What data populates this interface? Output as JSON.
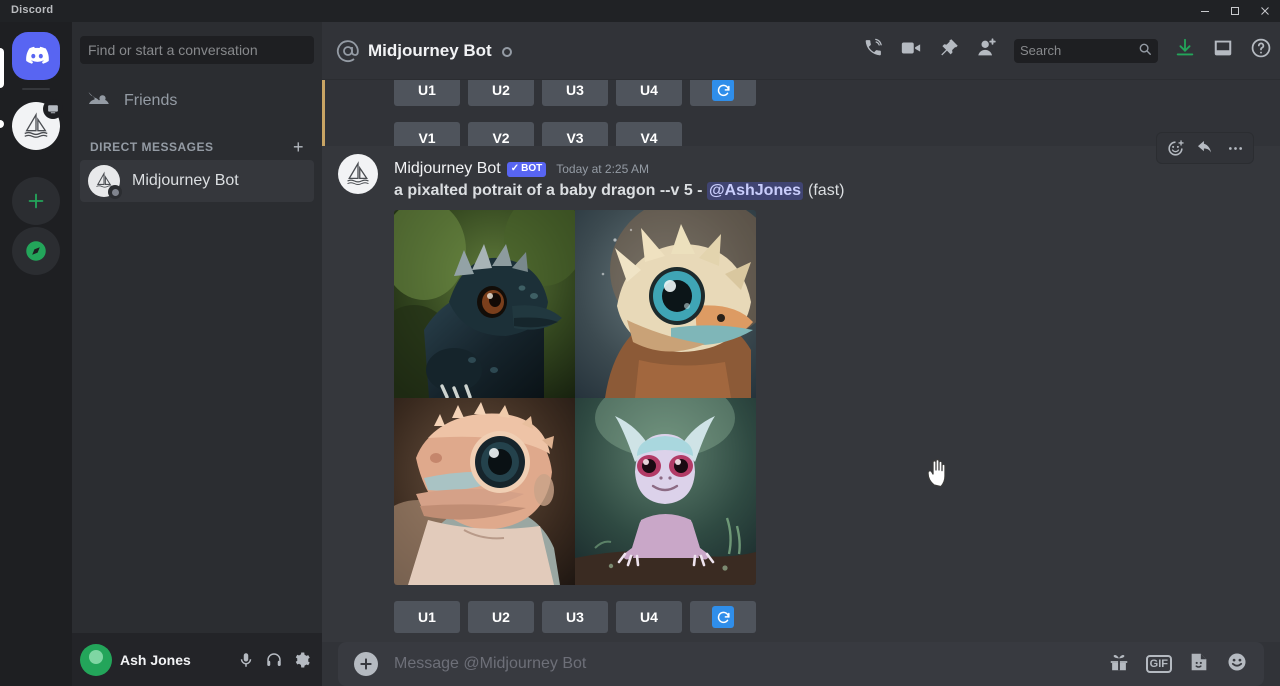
{
  "window": {
    "brand": "Discord",
    "controls": [
      {
        "name": "minimize",
        "glyph": "minimize-icon"
      },
      {
        "name": "maximize",
        "glyph": "maximize-icon"
      },
      {
        "name": "close",
        "glyph": "close-icon"
      }
    ]
  },
  "guild_rail": {
    "items": [
      {
        "name": "discord-home",
        "icon": "discord-logo-icon",
        "active": true
      },
      {
        "name": "midjourney-server",
        "icon": "sailboat-icon",
        "badge": "screen-icon"
      },
      {
        "name": "add-server",
        "icon": "plus-icon"
      },
      {
        "name": "explore-servers",
        "icon": "compass-icon"
      }
    ]
  },
  "sidebar": {
    "search_placeholder": "Find or start a conversation",
    "friends_label": "Friends",
    "dm_header": "DIRECT MESSAGES",
    "dm_add_label": "+",
    "conversations": [
      {
        "name": "Midjourney Bot",
        "status": "offline"
      }
    ]
  },
  "user_panel": {
    "username": "Ash Jones",
    "icons": [
      "microphone-icon",
      "headphones-icon",
      "settings-gear-icon"
    ]
  },
  "topbar": {
    "at_icon": "at-sign-icon",
    "channel_name": "Midjourney Bot",
    "status_icon": "status-circle-icon",
    "actions": [
      "call-icon",
      "video-call-icon",
      "pin-icon",
      "add-friend-icon"
    ],
    "search_placeholder": "Search",
    "right_actions": [
      "inbox-download-icon",
      "inbox-icon",
      "help-icon"
    ]
  },
  "chat": {
    "top_message": {
      "upscale_buttons": [
        "U1",
        "U2",
        "U3",
        "U4"
      ],
      "reroll_label": "reroll-icon",
      "variation_buttons": [
        "V1",
        "V2",
        "V3",
        "V4"
      ]
    },
    "message": {
      "author": "Midjourney Bot",
      "bot_badge": "BOT",
      "bot_badge_check": "✓",
      "timestamp": "Today at 2:25 AM",
      "prompt": "a pixalted potrait of a baby dragon --v 5 -",
      "mention": "@AshJones",
      "mode": "(fast)",
      "hover_actions": [
        "add-reaction-icon",
        "reply-icon",
        "more-options-icon"
      ],
      "images": [
        {
          "name": "baby-dragon-dark-green",
          "alt": "dark teal baby dragon on green foliage"
        },
        {
          "name": "baby-dragon-cream-orange",
          "alt": "cream and orange baby dragon with teal eye"
        },
        {
          "name": "baby-dragon-tan-lizard",
          "alt": "tan and pink lizard-like baby dragon"
        },
        {
          "name": "baby-dragon-violet",
          "alt": "violet and teal baby dragon on a branch"
        }
      ],
      "upscale_buttons": [
        "U1",
        "U2",
        "U3",
        "U4"
      ],
      "reroll_label": "reroll-icon"
    }
  },
  "composer": {
    "placeholder": "Message @Midjourney Bot",
    "plus_label": "+",
    "gif_label": "GIF",
    "icons": [
      "gift-icon",
      "gif-icon",
      "sticker-icon",
      "emoji-icon"
    ]
  },
  "colors": {
    "brand": "#5865f2",
    "accent_green": "#23a55a",
    "reroll_blue": "#2f8eea",
    "highlight_strip": "#c8a464",
    "chat_bg": "#313338",
    "sidebar_bg": "#2b2d31",
    "rail_bg": "#1e1f22"
  }
}
